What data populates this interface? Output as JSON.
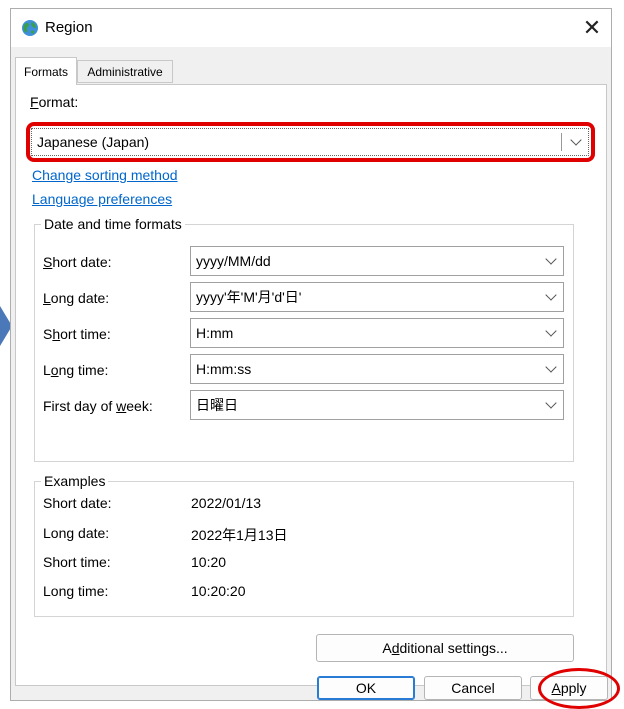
{
  "window": {
    "title": "Region",
    "close_glyph": "✕",
    "icon": "globe-icon"
  },
  "tabs": [
    {
      "label": "Formats",
      "active": true
    },
    {
      "label": "Administrative",
      "active": false
    }
  ],
  "format": {
    "label_acc": "F",
    "label_rest": "ormat:",
    "value": "Japanese (Japan)"
  },
  "links": {
    "sorting": "Change sorting method",
    "language": "Language preferences"
  },
  "datetime": {
    "group_title": "Date and time formats",
    "rows": [
      {
        "pre": "",
        "acc": "S",
        "post": "hort date:",
        "value": "yyyy/MM/dd"
      },
      {
        "pre": "",
        "acc": "L",
        "post": "ong date:",
        "value": "yyyy'年'M'月'd'日'"
      },
      {
        "pre": "S",
        "acc": "h",
        "post": "ort time:",
        "value": "H:mm"
      },
      {
        "pre": "L",
        "acc": "o",
        "post": "ng time:",
        "value": "H:mm:ss"
      },
      {
        "pre": "First day of ",
        "acc": "w",
        "post": "eek:",
        "value": "日曜日"
      }
    ]
  },
  "examples": {
    "group_title": "Examples",
    "rows": [
      {
        "label": "Short date:",
        "value": "2022/01/13"
      },
      {
        "label": "Long date:",
        "value": "2022年1月13日"
      },
      {
        "label": "Short time:",
        "value": "10:20"
      },
      {
        "label": "Long time:",
        "value": "10:20:20"
      }
    ]
  },
  "buttons": {
    "additional": {
      "pre": "A",
      "acc": "d",
      "post": "ditional settings..."
    },
    "ok": "OK",
    "cancel": "Cancel",
    "apply": {
      "acc": "A",
      "post": "pply"
    }
  },
  "colors": {
    "highlight": "#e00000",
    "link": "#0066cc",
    "arrow": "#4a78b8",
    "default_button": "#2a7bd4"
  }
}
